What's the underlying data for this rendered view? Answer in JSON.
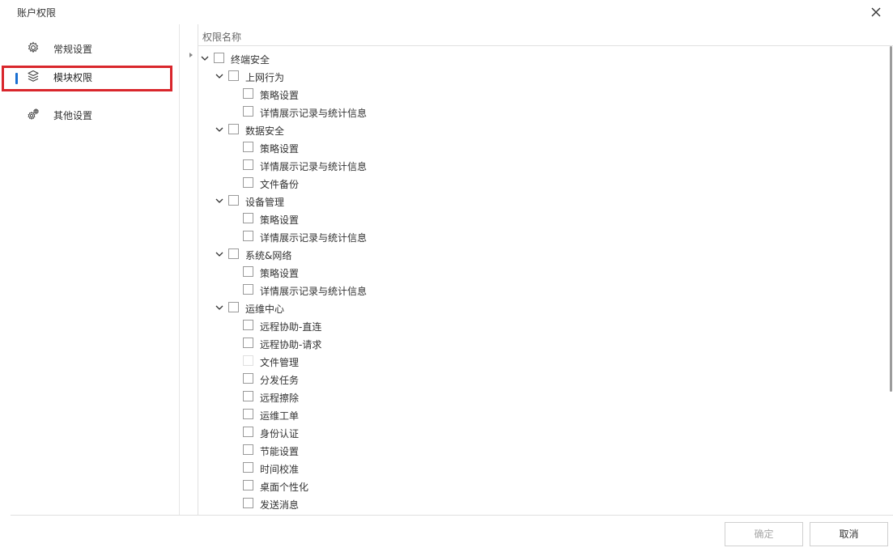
{
  "dialog": {
    "title": "账户权限"
  },
  "sidebar": {
    "items": [
      {
        "label": "常规设置",
        "icon": "gear-icon"
      },
      {
        "label": "模块权限",
        "icon": "layers-icon",
        "active": true
      },
      {
        "label": "其他设置",
        "icon": "gears-icon"
      }
    ]
  },
  "table": {
    "column_header": "权限名称"
  },
  "tree": [
    {
      "level": 0,
      "label": "终端安全",
      "expandable": true
    },
    {
      "level": 1,
      "label": "上网行为",
      "expandable": true
    },
    {
      "level": 2,
      "label": "策略设置"
    },
    {
      "level": 2,
      "label": "详情展示记录与统计信息"
    },
    {
      "level": 1,
      "label": "数据安全",
      "expandable": true
    },
    {
      "level": 2,
      "label": "策略设置"
    },
    {
      "level": 2,
      "label": "详情展示记录与统计信息"
    },
    {
      "level": 2,
      "label": "文件备份"
    },
    {
      "level": 1,
      "label": "设备管理",
      "expandable": true
    },
    {
      "level": 2,
      "label": "策略设置"
    },
    {
      "level": 2,
      "label": "详情展示记录与统计信息"
    },
    {
      "level": 1,
      "label": "系统&网络",
      "expandable": true
    },
    {
      "level": 2,
      "label": "策略设置"
    },
    {
      "level": 2,
      "label": "详情展示记录与统计信息"
    },
    {
      "level": 1,
      "label": "运维中心",
      "expandable": true
    },
    {
      "level": 2,
      "label": "远程协助-直连"
    },
    {
      "level": 2,
      "label": "远程协助-请求"
    },
    {
      "level": 2,
      "label": "文件管理",
      "faint": true
    },
    {
      "level": 2,
      "label": "分发任务"
    },
    {
      "level": 2,
      "label": "远程擦除"
    },
    {
      "level": 2,
      "label": "运维工单"
    },
    {
      "level": 2,
      "label": "身份认证"
    },
    {
      "level": 2,
      "label": "节能设置"
    },
    {
      "level": 2,
      "label": "时间校准"
    },
    {
      "level": 2,
      "label": "桌面个性化"
    },
    {
      "level": 2,
      "label": "发送消息"
    }
  ],
  "footer": {
    "ok_label": "确定",
    "cancel_label": "取消"
  },
  "colors": {
    "accent": "#1a6fd1",
    "highlight": "#d9262c"
  }
}
